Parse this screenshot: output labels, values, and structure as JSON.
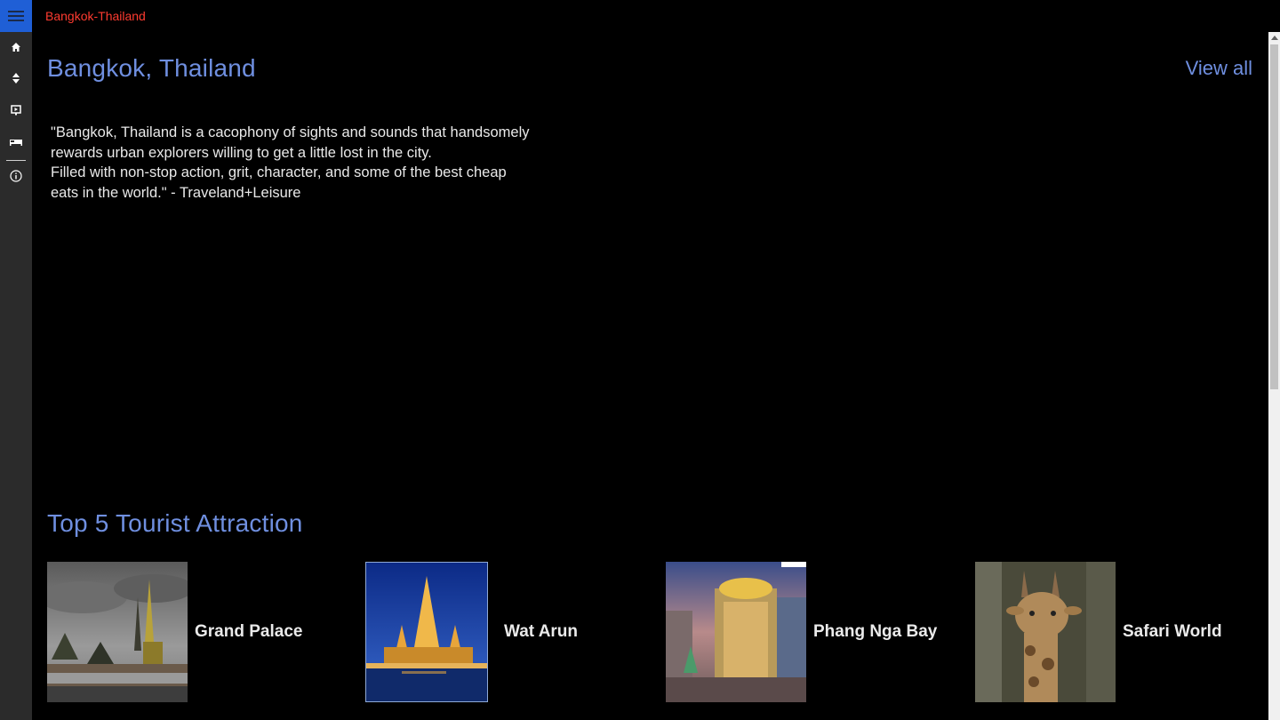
{
  "app": {
    "title": "Bangkok-Thailand"
  },
  "rail": {
    "items": [
      {
        "name": "home",
        "icon": "home-icon"
      },
      {
        "name": "attractions",
        "icon": "sort-icon"
      },
      {
        "name": "slideshow",
        "icon": "presentation-icon"
      },
      {
        "name": "hotels",
        "icon": "bed-icon"
      },
      {
        "name": "about",
        "icon": "info-icon"
      }
    ],
    "accent": "#1f5fd6"
  },
  "main": {
    "title": "Bangkok, Thailand",
    "view_all": "View all",
    "quote": "\"Bangkok, Thailand is a cacophony of sights and sounds that handsomely\nrewards urban explorers willing to get a little lost in the city.\nFilled with non-stop action, grit, character, and some of the best cheap\neats in the world.\" - Traveland+Leisure"
  },
  "attractions": {
    "title": "Top 5 Tourist Attraction",
    "items": [
      {
        "label": "Grand Palace"
      },
      {
        "label": "Wat Arun"
      },
      {
        "label": "Phang Nga Bay"
      },
      {
        "label": "Safari World"
      }
    ]
  },
  "colors": {
    "accent_text": "#6f8fe0",
    "app_title": "#ff3b30",
    "background": "#000000"
  }
}
